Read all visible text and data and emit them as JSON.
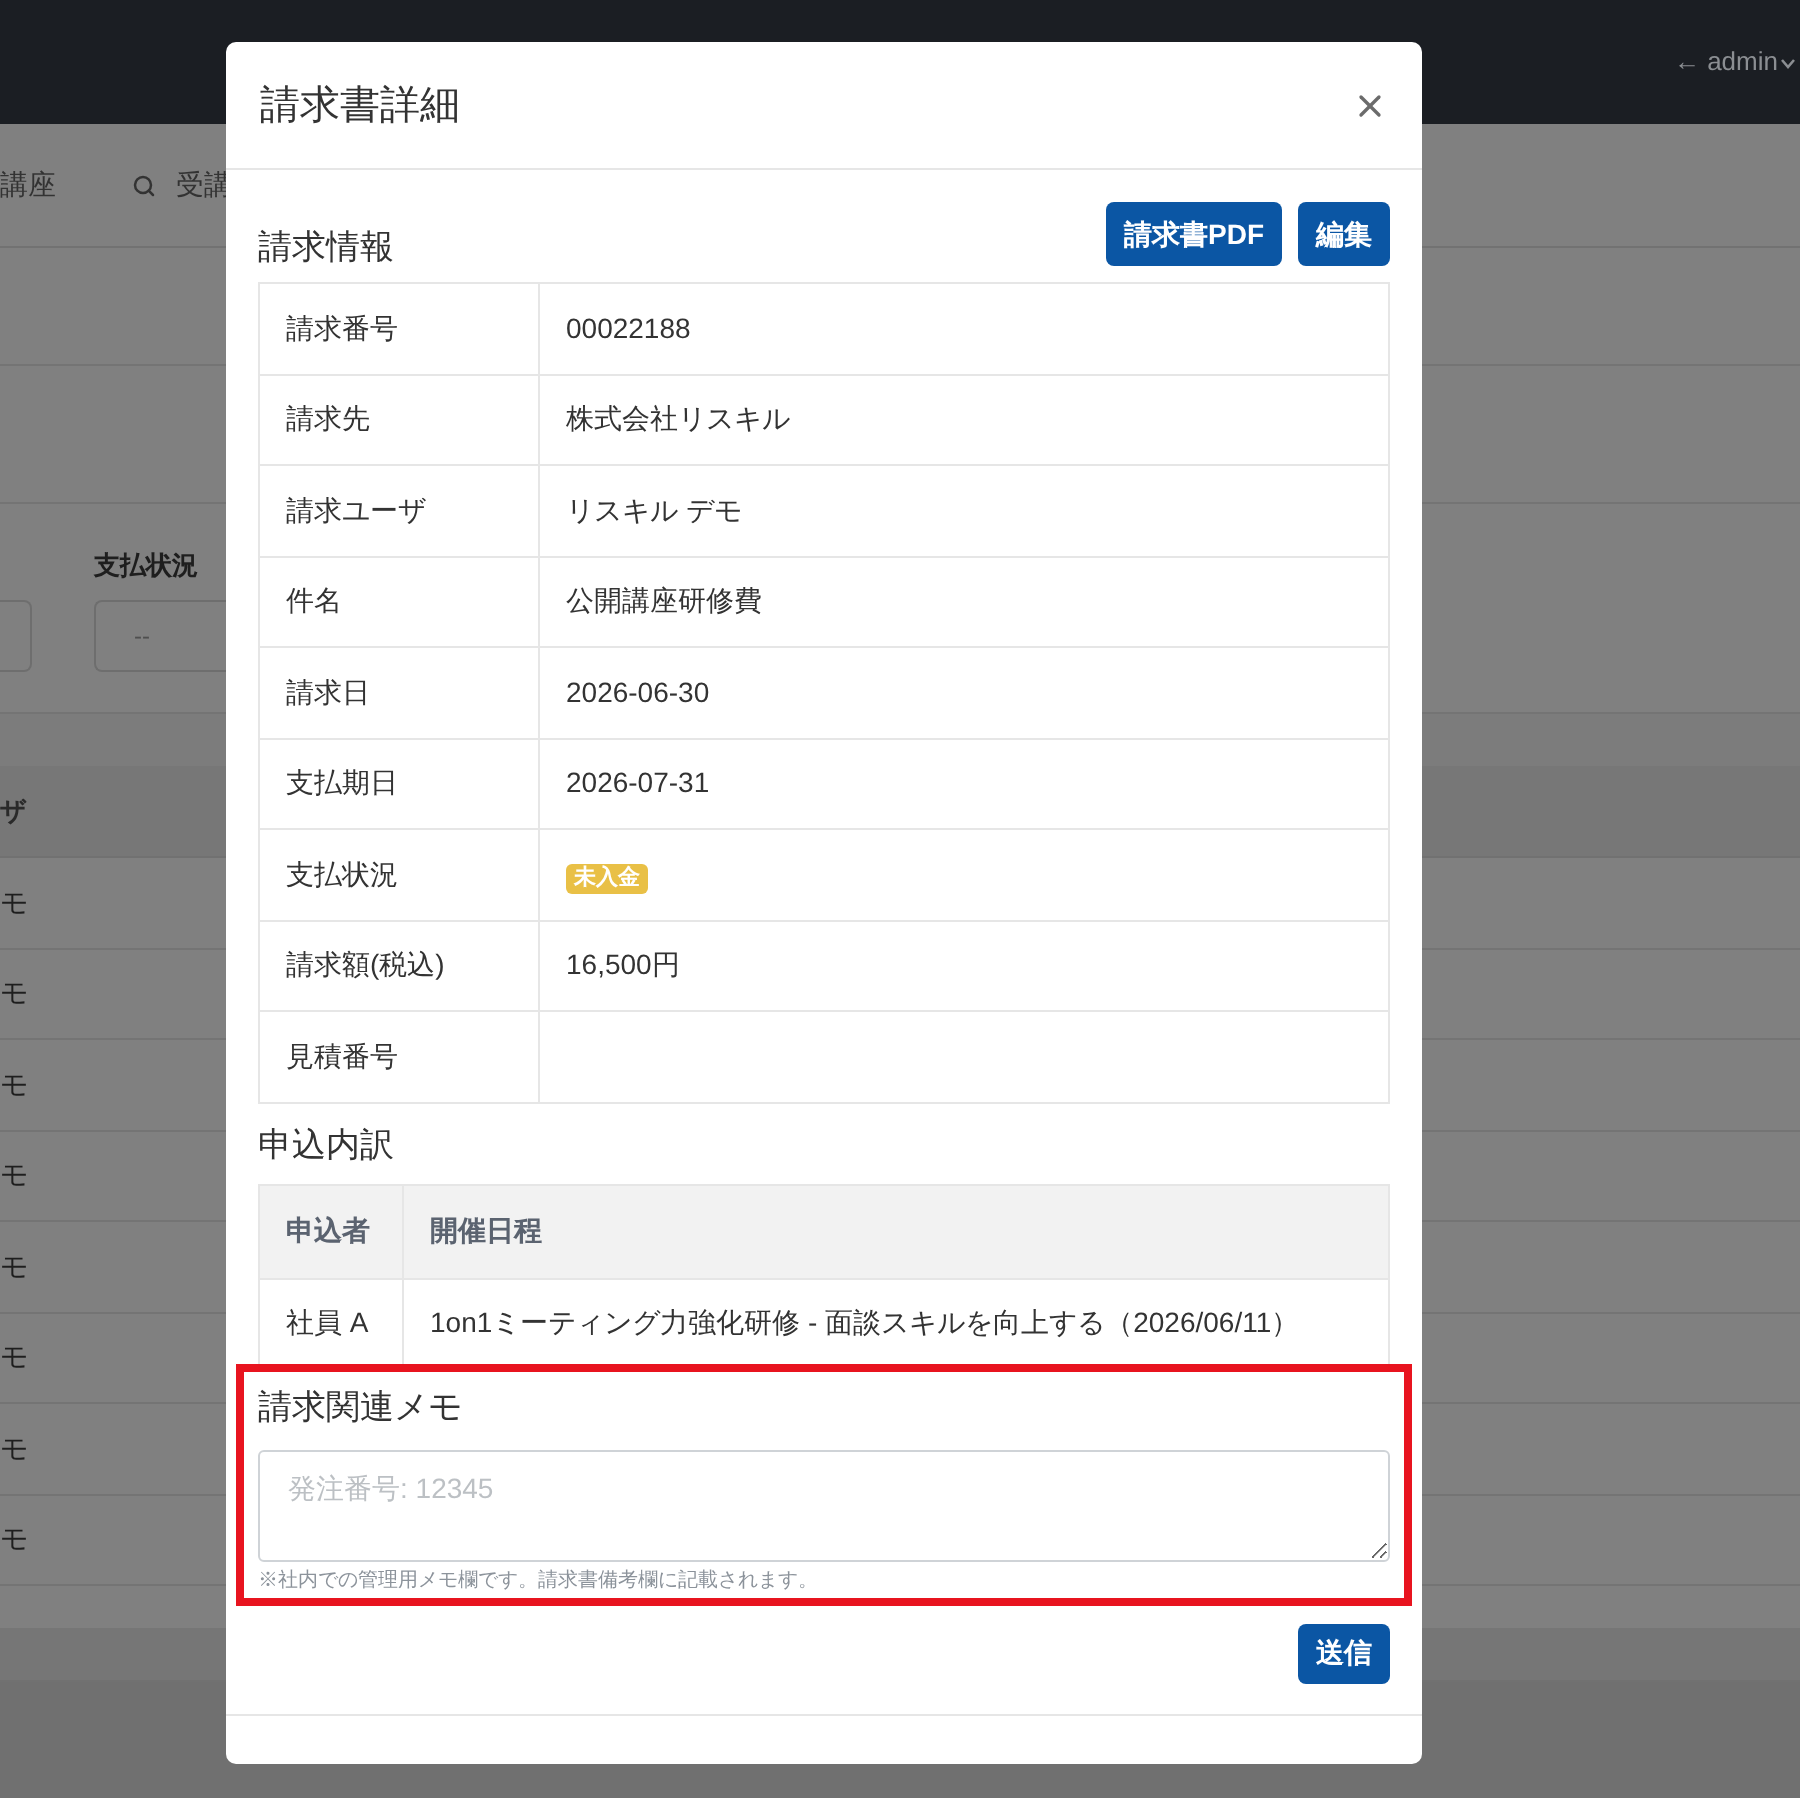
{
  "background_page": {
    "nav": {
      "user_link": "← admin"
    },
    "tabs": [
      {
        "kind": "text",
        "label": "講座"
      },
      {
        "kind": "search",
        "label": "受講"
      }
    ],
    "filters": [
      {
        "label": "支払状況",
        "value": "--"
      }
    ],
    "table": {
      "columns": [
        "ザ"
      ],
      "rows": [
        [
          "モ"
        ],
        [
          "モ"
        ],
        [
          "モ"
        ],
        [
          "モ"
        ],
        [
          "モ"
        ],
        [
          "モ"
        ],
        [
          "モ"
        ],
        [
          "モ"
        ]
      ]
    }
  },
  "modal": {
    "title": "請求書詳細",
    "invoice_section": {
      "heading": "請求情報",
      "buttons": [
        "請求書PDF",
        "編集"
      ],
      "fields": [
        {
          "kind": "text",
          "label": "請求番号",
          "value": "00022188"
        },
        {
          "kind": "text",
          "label": "請求先",
          "value": "株式会社リスキル"
        },
        {
          "kind": "text",
          "label": "請求ユーザ",
          "value": "リスキル デモ"
        },
        {
          "kind": "text",
          "label": "件名",
          "value": "公開講座研修費"
        },
        {
          "kind": "text",
          "label": "請求日",
          "value": "2026-06-30"
        },
        {
          "kind": "text",
          "label": "支払期日",
          "value": "2026-07-31"
        },
        {
          "kind": "badge",
          "label": "支払状況",
          "value": "未入金"
        },
        {
          "kind": "text",
          "label": "請求額(税込)",
          "value": "16,500円"
        },
        {
          "kind": "text",
          "label": "見積番号"
        }
      ]
    },
    "applications": {
      "heading": "申込内訳",
      "columns": [
        "申込者",
        "開催日程"
      ],
      "rows": [
        [
          "社員 A",
          "1on1ミーティング力強化研修 - 面談スキルを向上する（2026/06/11）"
        ]
      ]
    },
    "memo": {
      "heading": "請求関連メモ",
      "highlighted": true,
      "placeholder": "発注番号: 12345",
      "help": "※社内での管理用メモ欄です。請求書備考欄に記載されます。"
    },
    "submit_button": "送信"
  }
}
